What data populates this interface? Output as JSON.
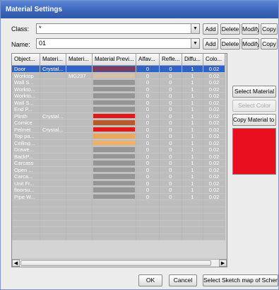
{
  "window": {
    "title": "Material Settings"
  },
  "class_row": {
    "label": "Class:",
    "value": "*",
    "add": "Add",
    "delete": "Delete",
    "modify": "Modify",
    "copy": "Copy"
  },
  "name_row": {
    "label": "Name:",
    "value": "01",
    "add": "Add",
    "delete": "Delete",
    "modify": "Modify",
    "copy": "Copy"
  },
  "table": {
    "columns": [
      "Object...",
      "Materi...",
      "Materi...",
      "Material Previ...",
      "Alfav...",
      "Refle...",
      "Diffu...",
      "Colo..."
    ],
    "rows": [
      {
        "object": "Door",
        "mat1": "Crystal...",
        "mat2": "",
        "preview": "#7d3a5a",
        "alfa": "0",
        "refl": "0",
        "diff": "1",
        "color": "0.02",
        "selected": true
      },
      {
        "object": "Worktop",
        "mat1": "",
        "mat2": "MG237",
        "preview": "#d8c0a8",
        "alfa": "0",
        "refl": "0",
        "diff": "1",
        "color": "0.02"
      },
      {
        "object": "Wall S...",
        "mat1": "",
        "mat2": "",
        "preview": "#959595",
        "alfa": "0",
        "refl": "0",
        "diff": "1",
        "color": "0.02"
      },
      {
        "object": "Workto...",
        "mat1": "",
        "mat2": "",
        "preview": "#959595",
        "alfa": "0",
        "refl": "0",
        "diff": "1",
        "color": "0.02"
      },
      {
        "object": "Workto...",
        "mat1": "",
        "mat2": "",
        "preview": "#959595",
        "alfa": "0",
        "refl": "0",
        "diff": "1",
        "color": "0.02"
      },
      {
        "object": "Wall S...",
        "mat1": "",
        "mat2": "",
        "preview": "#959595",
        "alfa": "0",
        "refl": "0",
        "diff": "1",
        "color": "0.02"
      },
      {
        "object": "End P...",
        "mat1": "",
        "mat2": "",
        "preview": "#959595",
        "alfa": "0",
        "refl": "0",
        "diff": "1",
        "color": "0.02"
      },
      {
        "object": "Plinth",
        "mat1": "Crystal...",
        "mat2": "",
        "preview": "#e11818",
        "alfa": "0",
        "refl": "0",
        "diff": "1",
        "color": "0.02"
      },
      {
        "object": "Cornice",
        "mat1": "",
        "mat2": "",
        "preview": "#b85a2a",
        "alfa": "0",
        "refl": "0",
        "diff": "1",
        "color": "0.02"
      },
      {
        "object": "Pelmet",
        "mat1": "Crystal...",
        "mat2": "",
        "preview": "#e11818",
        "alfa": "0",
        "refl": "0",
        "diff": "1",
        "color": "0.02"
      },
      {
        "object": "Top pa...",
        "mat1": "",
        "mat2": "",
        "preview": "#eba85a",
        "alfa": "0",
        "refl": "0",
        "diff": "1",
        "color": "0.02"
      },
      {
        "object": "Ceiling...",
        "mat1": "",
        "mat2": "",
        "preview": "#f2b266",
        "alfa": "0",
        "refl": "0",
        "diff": "1",
        "color": "0.02"
      },
      {
        "object": "Drawe...",
        "mat1": "",
        "mat2": "",
        "preview": "#959595",
        "alfa": "0",
        "refl": "0",
        "diff": "1",
        "color": "0.02"
      },
      {
        "object": "BackP...",
        "mat1": "",
        "mat2": "",
        "preview": "#959595",
        "alfa": "0",
        "refl": "0",
        "diff": "1",
        "color": "0.02"
      },
      {
        "object": "Carcass",
        "mat1": "",
        "mat2": "",
        "preview": "#959595",
        "alfa": "0",
        "refl": "0",
        "diff": "1",
        "color": "0.02"
      },
      {
        "object": "Open ...",
        "mat1": "",
        "mat2": "",
        "preview": "#959595",
        "alfa": "0",
        "refl": "0",
        "diff": "1",
        "color": "0.02"
      },
      {
        "object": "Carca...",
        "mat1": "",
        "mat2": "",
        "preview": "#959595",
        "alfa": "0",
        "refl": "0",
        "diff": "1",
        "color": "0.02"
      },
      {
        "object": "Unit Fr...",
        "mat1": "",
        "mat2": "",
        "preview": "#959595",
        "alfa": "0",
        "refl": "0",
        "diff": "1",
        "color": "0.02"
      },
      {
        "object": "floorsu...",
        "mat1": "",
        "mat2": "",
        "preview": "#959595",
        "alfa": "0",
        "refl": "0",
        "diff": "1",
        "color": "0.02"
      },
      {
        "object": "Pipe W...",
        "mat1": "",
        "mat2": "",
        "preview": "#959595",
        "alfa": "0",
        "refl": "0",
        "diff": "1",
        "color": "0.02"
      }
    ]
  },
  "side_buttons": {
    "select_material": "Select Material",
    "select_color": "Select Color",
    "copy_material": "Copy Material to >"
  },
  "preview_color": "#e8101f",
  "bottom": {
    "ok": "OK",
    "cancel": "Cancel",
    "sketch": "Select Sketch map of Scheme >"
  },
  "icons": {
    "dropdown": "chevron-down-icon",
    "scroll_left": "arrow-left-icon",
    "scroll_right": "arrow-right-icon"
  }
}
